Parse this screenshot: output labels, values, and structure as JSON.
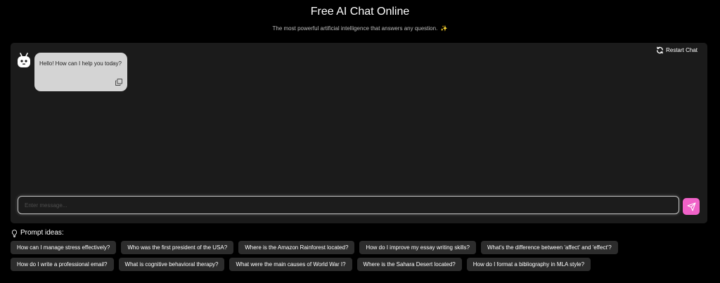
{
  "header": {
    "title": "Free AI Chat Online",
    "subtitle": "The most powerful artificial intelligence that answers any question.",
    "subtitle_emoji": "✨"
  },
  "chat": {
    "restart_label": "Restart Chat",
    "messages": [
      {
        "role": "bot",
        "text": "Hello! How can I help you today?"
      }
    ],
    "input": {
      "value": "",
      "placeholder": "Enter message..."
    }
  },
  "prompts": {
    "label": "Prompt ideas:",
    "row1": [
      "How can I manage stress effectively?",
      "Who was the first president of the USA?",
      "Where is the Amazon Rainforest located?",
      "How do I improve my essay writing skills?",
      "What's the difference between 'affect' and 'effect'?"
    ],
    "row2": [
      "How do I write a professional email?",
      "What is cognitive behavioral therapy?",
      "What were the main causes of World War I?",
      "Where is the Sahara Desert located?",
      "How do I format a bibliography in MLA style?"
    ]
  },
  "colors": {
    "background": "#000000",
    "panel": "#1b1b1b",
    "bubble": "#d4d4d4",
    "chip": "#2c2c2c",
    "send_accent": "#f062c8"
  },
  "icons": {
    "restart": "refresh-icon",
    "avatar": "robot-icon",
    "copy": "copy-icon",
    "send": "paper-plane-icon",
    "prompt": "lightbulb-icon"
  }
}
